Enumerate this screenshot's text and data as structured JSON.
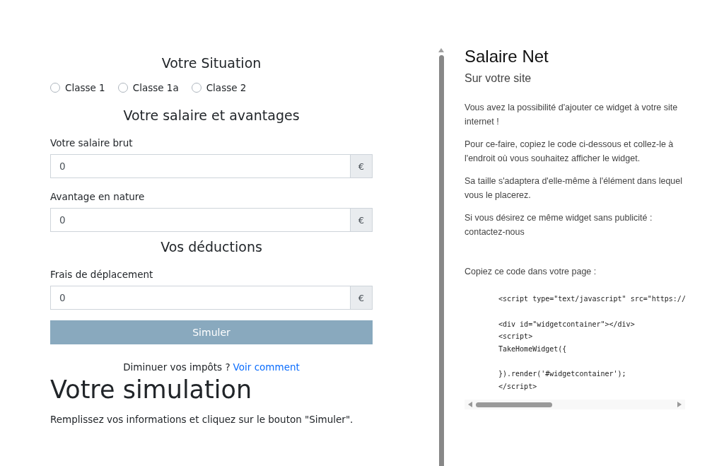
{
  "situation": {
    "title": "Votre Situation",
    "options": [
      {
        "label": "Classe 1",
        "selected": false
      },
      {
        "label": "Classe 1a",
        "selected": false
      },
      {
        "label": "Classe 2",
        "selected": false
      }
    ]
  },
  "sections": [
    {
      "title": "Votre salaire et avantages",
      "fields": [
        {
          "label": "Votre salaire brut",
          "value": "0",
          "unit": "€"
        },
        {
          "label": "Avantage en nature",
          "value": "0",
          "unit": "€"
        }
      ]
    },
    {
      "title": "Vos déductions",
      "fields": [
        {
          "label": "Frais de déplacement",
          "value": "0",
          "unit": "€"
        }
      ]
    }
  ],
  "simulate_button": "Simuler",
  "tip": {
    "text": "Diminuer vos impôts ?",
    "link": "Voir comment"
  },
  "result": {
    "title": "Votre simulation",
    "text": "Remplissez vos informations et cliquez sur le bouton \"Simuler\"."
  },
  "widget": {
    "title": "Salaire Net",
    "subtitle": "Sur votre site",
    "paragraphs": [
      "Vous avez la possibilité d'ajouter ce widget à votre site internet !",
      "Pour ce-faire, copiez le code ci-dessous et collez-le à l'endroit où vous souhaitez afficher le widget.",
      "Sa taille s'adaptera d'elle-même à l'élément dans lequel vous le placerez.",
      "Si vous désirez ce même widget sans publicité : contactez-nous"
    ],
    "code_intro": "Copiez ce code dans votre page :",
    "code_blocks": [
      [
        "<script type=\"text/javascript\" src=\"https://"
      ],
      [
        "<div id=\"widgetcontainer\"></div>",
        "<script>",
        "TakeHomeWidget({"
      ],
      [
        "}).render('#widgetcontainer');",
        "</script>"
      ]
    ]
  }
}
